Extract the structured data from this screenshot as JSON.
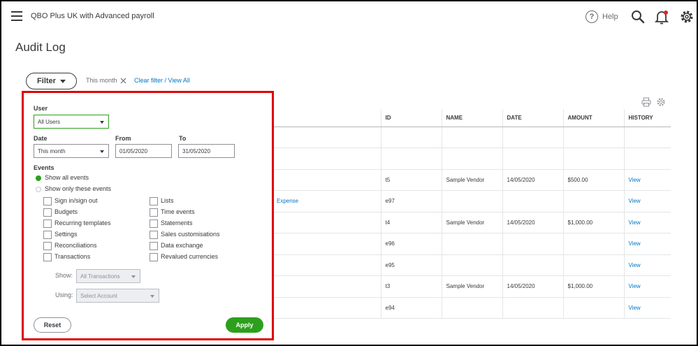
{
  "header": {
    "company_name": "QBO Plus UK with Advanced payroll",
    "help_label": "Help",
    "icons": [
      "hamburger-menu-icon",
      "help-icon",
      "search-icon",
      "bell-icon",
      "gear-icon"
    ],
    "notification_color": "#d52b1e"
  },
  "page": {
    "title": "Audit Log",
    "filter_button": "Filter",
    "active_filter": "This month",
    "clear_link": "Clear filter / View All"
  },
  "filter_panel": {
    "user_label": "User",
    "user_value": "All Users",
    "date_label": "Date",
    "date_value": "This month",
    "from_label": "From",
    "from_value": "01/05/2020",
    "to_label": "To",
    "to_value": "31/05/2020",
    "events_label": "Events",
    "show_all_events": "Show all events",
    "show_only_events": "Show only these events",
    "event_options_left": [
      "Sign in/sign out",
      "Budgets",
      "Recurring templates",
      "Settings",
      "Reconciliations",
      "Transactions"
    ],
    "event_options_right": [
      "Lists",
      "Time events",
      "Statements",
      "Sales customisations",
      "Data exchange",
      "Revalued currencies"
    ],
    "show_label": "Show:",
    "show_value": "All Transactions",
    "using_label": "Using:",
    "using_placeholder": "Select Account",
    "reset_button": "Reset",
    "apply_button": "Apply"
  },
  "table": {
    "columns": [
      "ID",
      "NAME",
      "DATE",
      "AMOUNT",
      "HISTORY"
    ],
    "rows": [
      {
        "event": "",
        "id": "",
        "name": "",
        "date": "",
        "amount": "",
        "history": ""
      },
      {
        "event": "",
        "id": "",
        "name": "",
        "date": "",
        "amount": "",
        "history": ""
      },
      {
        "event": "",
        "id": "t5",
        "name": "Sample Vendor",
        "date": "14/05/2020",
        "amount": "$500.00",
        "history": "View"
      },
      {
        "event": "Expense",
        "id": "e97",
        "name": "",
        "date": "",
        "amount": "",
        "history": "View"
      },
      {
        "event": "",
        "id": "t4",
        "name": "Sample Vendor",
        "date": "14/05/2020",
        "amount": "$1,000.00",
        "history": "View"
      },
      {
        "event": "",
        "id": "e96",
        "name": "",
        "date": "",
        "amount": "",
        "history": "View"
      },
      {
        "event": "",
        "id": "e95",
        "name": "",
        "date": "",
        "amount": "",
        "history": "View"
      },
      {
        "event": "",
        "id": "t3",
        "name": "Sample Vendor",
        "date": "14/05/2020",
        "amount": "$1,000.00",
        "history": "View"
      },
      {
        "event": "",
        "id": "e94",
        "name": "",
        "date": "",
        "amount": "",
        "history": "View"
      }
    ]
  },
  "colors": {
    "accent_green": "#2ca01c",
    "link_blue": "#0077c5",
    "highlight_red": "#e00000"
  }
}
